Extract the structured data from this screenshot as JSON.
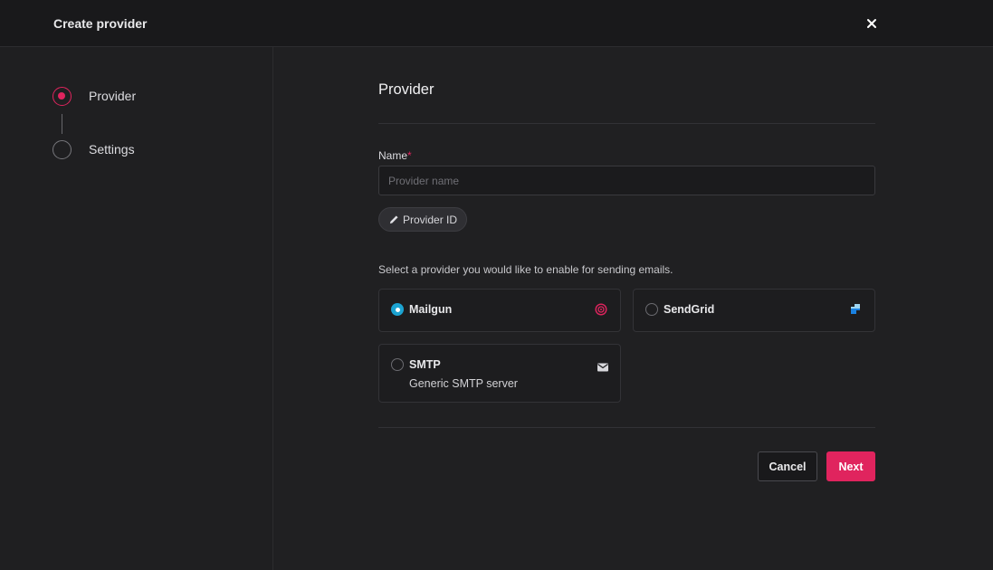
{
  "header": {
    "title": "Create provider",
    "close_icon": "close-icon"
  },
  "steps": [
    {
      "label": "Provider",
      "state": "active"
    },
    {
      "label": "Settings",
      "state": "inactive"
    }
  ],
  "form": {
    "section_title": "Provider",
    "name_label": "Name",
    "required_mark": "*",
    "name_placeholder": "Provider name",
    "name_value": "",
    "provider_id_chip": "Provider ID",
    "help_text": "Select a provider you would like to enable for sending emails."
  },
  "providers": [
    {
      "name": "Mailgun",
      "description": "",
      "selected": true,
      "icon": "mailgun-logo-icon"
    },
    {
      "name": "SendGrid",
      "description": "",
      "selected": false,
      "icon": "sendgrid-logo-icon"
    },
    {
      "name": "SMTP",
      "description": "Generic SMTP server",
      "selected": false,
      "icon": "mail-envelope-icon"
    }
  ],
  "actions": {
    "cancel_label": "Cancel",
    "next_label": "Next"
  },
  "colors": {
    "accent": "#e0245e",
    "radio_selected": "#1ca3d1",
    "background": "#202022",
    "header_background": "#19191b"
  }
}
